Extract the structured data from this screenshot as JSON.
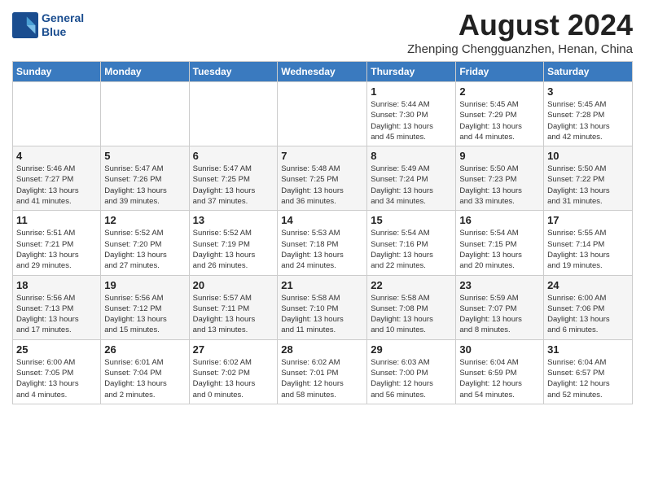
{
  "header": {
    "logo_line1": "General",
    "logo_line2": "Blue",
    "month_title": "August 2024",
    "location": "Zhenping Chengguanzhen, Henan, China"
  },
  "weekdays": [
    "Sunday",
    "Monday",
    "Tuesday",
    "Wednesday",
    "Thursday",
    "Friday",
    "Saturday"
  ],
  "weeks": [
    [
      {
        "day": "",
        "info": ""
      },
      {
        "day": "",
        "info": ""
      },
      {
        "day": "",
        "info": ""
      },
      {
        "day": "",
        "info": ""
      },
      {
        "day": "1",
        "info": "Sunrise: 5:44 AM\nSunset: 7:30 PM\nDaylight: 13 hours\nand 45 minutes."
      },
      {
        "day": "2",
        "info": "Sunrise: 5:45 AM\nSunset: 7:29 PM\nDaylight: 13 hours\nand 44 minutes."
      },
      {
        "day": "3",
        "info": "Sunrise: 5:45 AM\nSunset: 7:28 PM\nDaylight: 13 hours\nand 42 minutes."
      }
    ],
    [
      {
        "day": "4",
        "info": "Sunrise: 5:46 AM\nSunset: 7:27 PM\nDaylight: 13 hours\nand 41 minutes."
      },
      {
        "day": "5",
        "info": "Sunrise: 5:47 AM\nSunset: 7:26 PM\nDaylight: 13 hours\nand 39 minutes."
      },
      {
        "day": "6",
        "info": "Sunrise: 5:47 AM\nSunset: 7:25 PM\nDaylight: 13 hours\nand 37 minutes."
      },
      {
        "day": "7",
        "info": "Sunrise: 5:48 AM\nSunset: 7:25 PM\nDaylight: 13 hours\nand 36 minutes."
      },
      {
        "day": "8",
        "info": "Sunrise: 5:49 AM\nSunset: 7:24 PM\nDaylight: 13 hours\nand 34 minutes."
      },
      {
        "day": "9",
        "info": "Sunrise: 5:50 AM\nSunset: 7:23 PM\nDaylight: 13 hours\nand 33 minutes."
      },
      {
        "day": "10",
        "info": "Sunrise: 5:50 AM\nSunset: 7:22 PM\nDaylight: 13 hours\nand 31 minutes."
      }
    ],
    [
      {
        "day": "11",
        "info": "Sunrise: 5:51 AM\nSunset: 7:21 PM\nDaylight: 13 hours\nand 29 minutes."
      },
      {
        "day": "12",
        "info": "Sunrise: 5:52 AM\nSunset: 7:20 PM\nDaylight: 13 hours\nand 27 minutes."
      },
      {
        "day": "13",
        "info": "Sunrise: 5:52 AM\nSunset: 7:19 PM\nDaylight: 13 hours\nand 26 minutes."
      },
      {
        "day": "14",
        "info": "Sunrise: 5:53 AM\nSunset: 7:18 PM\nDaylight: 13 hours\nand 24 minutes."
      },
      {
        "day": "15",
        "info": "Sunrise: 5:54 AM\nSunset: 7:16 PM\nDaylight: 13 hours\nand 22 minutes."
      },
      {
        "day": "16",
        "info": "Sunrise: 5:54 AM\nSunset: 7:15 PM\nDaylight: 13 hours\nand 20 minutes."
      },
      {
        "day": "17",
        "info": "Sunrise: 5:55 AM\nSunset: 7:14 PM\nDaylight: 13 hours\nand 19 minutes."
      }
    ],
    [
      {
        "day": "18",
        "info": "Sunrise: 5:56 AM\nSunset: 7:13 PM\nDaylight: 13 hours\nand 17 minutes."
      },
      {
        "day": "19",
        "info": "Sunrise: 5:56 AM\nSunset: 7:12 PM\nDaylight: 13 hours\nand 15 minutes."
      },
      {
        "day": "20",
        "info": "Sunrise: 5:57 AM\nSunset: 7:11 PM\nDaylight: 13 hours\nand 13 minutes."
      },
      {
        "day": "21",
        "info": "Sunrise: 5:58 AM\nSunset: 7:10 PM\nDaylight: 13 hours\nand 11 minutes."
      },
      {
        "day": "22",
        "info": "Sunrise: 5:58 AM\nSunset: 7:08 PM\nDaylight: 13 hours\nand 10 minutes."
      },
      {
        "day": "23",
        "info": "Sunrise: 5:59 AM\nSunset: 7:07 PM\nDaylight: 13 hours\nand 8 minutes."
      },
      {
        "day": "24",
        "info": "Sunrise: 6:00 AM\nSunset: 7:06 PM\nDaylight: 13 hours\nand 6 minutes."
      }
    ],
    [
      {
        "day": "25",
        "info": "Sunrise: 6:00 AM\nSunset: 7:05 PM\nDaylight: 13 hours\nand 4 minutes."
      },
      {
        "day": "26",
        "info": "Sunrise: 6:01 AM\nSunset: 7:04 PM\nDaylight: 13 hours\nand 2 minutes."
      },
      {
        "day": "27",
        "info": "Sunrise: 6:02 AM\nSunset: 7:02 PM\nDaylight: 13 hours\nand 0 minutes."
      },
      {
        "day": "28",
        "info": "Sunrise: 6:02 AM\nSunset: 7:01 PM\nDaylight: 12 hours\nand 58 minutes."
      },
      {
        "day": "29",
        "info": "Sunrise: 6:03 AM\nSunset: 7:00 PM\nDaylight: 12 hours\nand 56 minutes."
      },
      {
        "day": "30",
        "info": "Sunrise: 6:04 AM\nSunset: 6:59 PM\nDaylight: 12 hours\nand 54 minutes."
      },
      {
        "day": "31",
        "info": "Sunrise: 6:04 AM\nSunset: 6:57 PM\nDaylight: 12 hours\nand 52 minutes."
      }
    ]
  ]
}
